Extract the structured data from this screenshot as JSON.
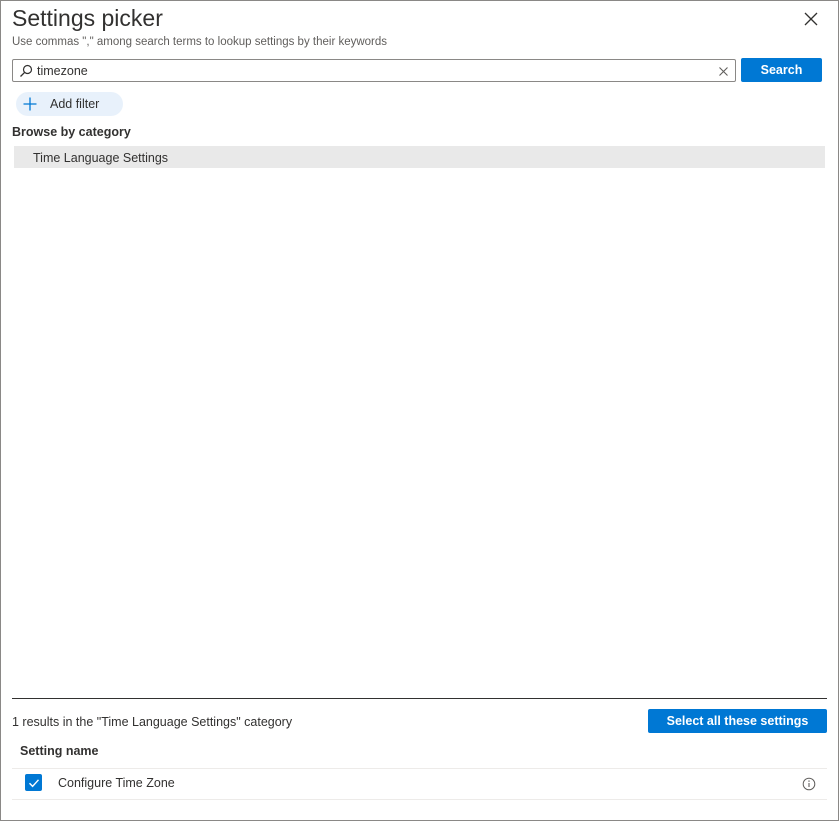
{
  "header": {
    "title": "Settings picker",
    "subtitle": "Use commas \",\" among search terms to lookup settings by their keywords"
  },
  "icons": {
    "close": "close-icon",
    "search": "search-icon",
    "clear": "clear-icon",
    "add": "plus-icon",
    "check": "checkmark-icon",
    "info": "info-icon"
  },
  "search": {
    "value": "timezone",
    "placeholder": "",
    "button_label": "Search"
  },
  "filter": {
    "add_label": "Add filter"
  },
  "browse": {
    "heading": "Browse by category",
    "categories": [
      {
        "label": "Time Language Settings",
        "selected": true
      }
    ]
  },
  "results": {
    "summary": "1 results in the \"Time Language Settings\" category",
    "select_all_label": "Select all these settings",
    "column_header": "Setting name",
    "rows": [
      {
        "label": "Configure Time Zone",
        "checked": true
      }
    ]
  },
  "colors": {
    "accent": "#0078d4",
    "selected_row": "#e9e9e9",
    "filter_pill": "#e8f1fb",
    "text": "#323130"
  }
}
